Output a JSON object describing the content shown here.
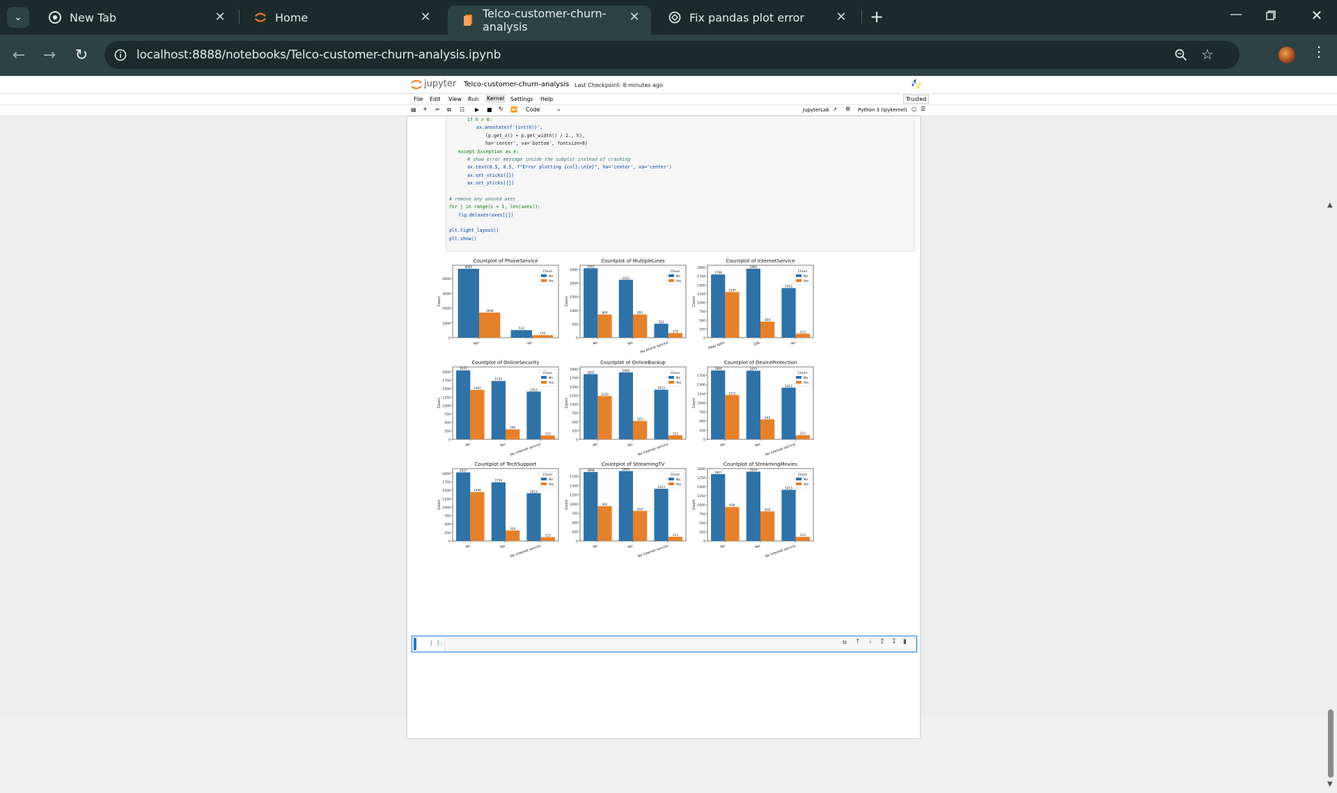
{
  "browser": {
    "tabs": [
      {
        "title": "New Tab",
        "icon": "chrome-icon"
      },
      {
        "title": "Home",
        "icon": "jupyter-icon"
      },
      {
        "title": "Telco-customer-churn-analysis",
        "icon": "notebook-icon"
      },
      {
        "title": "Fix pandas plot error",
        "icon": "chatgpt-icon"
      }
    ],
    "url": "localhost:8888/notebooks/Telco-customer-churn-analysis.ipynb"
  },
  "jupyter": {
    "logo_text": "jupyter",
    "notebook_title": "Telco-customer-churn-analysis",
    "checkpoint": "Last Checkpoint: 8 minutes ago",
    "menu": [
      "File",
      "Edit",
      "View",
      "Run",
      "Kernel",
      "Settings",
      "Help"
    ],
    "trusted": "Trusted",
    "cell_type": "Code",
    "jupyterlab_link": "JupyterLab",
    "kernel": "Python 3 (ipykernel)",
    "empty_prompt": "[ ]:"
  },
  "code_lines": [
    {
      "indent": 4,
      "html": "if h > 0:"
    },
    {
      "indent": 6,
      "html": "ax.annotate(f'{int(h)}',"
    },
    {
      "indent": 8,
      "html": "(p.get_x() + p.get_width() / 2., h),"
    },
    {
      "indent": 8,
      "html": "ha='center', va='bottom', fontsize=8)"
    },
    {
      "indent": 2,
      "html": "except Exception as e:"
    },
    {
      "indent": 4,
      "html": "# show error message inside the subplot instead of crashing"
    },
    {
      "indent": 4,
      "html": "ax.text(0.5, 0.5, f\"Error plotting {col}:\\n{e}\", ha='center', va='center')"
    },
    {
      "indent": 4,
      "html": "ax.set_xticks([])"
    },
    {
      "indent": 4,
      "html": "ax.set_yticks([])"
    },
    {
      "indent": 0,
      "html": ""
    },
    {
      "indent": 0,
      "html": "# remove any unused axes"
    },
    {
      "indent": 0,
      "html": "for j in range(i + 1, len(axes)):"
    },
    {
      "indent": 2,
      "html": "fig.delaxes(axes[j])"
    },
    {
      "indent": 0,
      "html": ""
    },
    {
      "indent": 0,
      "html": "plt.tight_layout()"
    },
    {
      "indent": 0,
      "html": "plt.show()"
    }
  ],
  "chart_data": [
    {
      "type": "bar",
      "title": "Countplot of PhoneService",
      "ylabel": "Count",
      "categories": [
        "Yes",
        "No"
      ],
      "ylim": [
        0,
        4900
      ],
      "yticks": [
        0,
        1000,
        2000,
        3000,
        4000
      ],
      "legend_title": "Churn",
      "series": [
        {
          "name": "No",
          "values": [
            4662,
            512
          ]
        },
        {
          "name": "Yes",
          "values": [
            1699,
            170
          ]
        }
      ]
    },
    {
      "type": "bar",
      "title": "Countplot of MultipleLines",
      "ylabel": "Count",
      "categories": [
        "No",
        "Yes",
        "No phone service"
      ],
      "ylim": [
        0,
        2650
      ],
      "yticks": [
        0,
        500,
        1000,
        1500,
        2000,
        2500
      ],
      "legend_title": "Churn",
      "series": [
        {
          "name": "No",
          "values": [
            2541,
            2121,
            512
          ]
        },
        {
          "name": "Yes",
          "values": [
            849,
            850,
            170
          ]
        }
      ]
    },
    {
      "type": "bar",
      "title": "Countplot of InternetService",
      "ylabel": "Count",
      "categories": [
        "Fiber optic",
        "DSL",
        "No"
      ],
      "ylim": [
        0,
        2060
      ],
      "yticks": [
        0,
        250,
        500,
        750,
        1000,
        1250,
        1500,
        1750,
        2000
      ],
      "legend_title": "Churn",
      "series": [
        {
          "name": "No",
          "values": [
            1799,
            1962,
            1413
          ]
        },
        {
          "name": "Yes",
          "values": [
            1297,
            459,
            113
          ]
        }
      ]
    },
    {
      "type": "bar",
      "title": "Countplot of OnlineSecurity",
      "ylabel": "Count",
      "categories": [
        "No",
        "Yes",
        "No internet service"
      ],
      "ylim": [
        0,
        2140
      ],
      "yticks": [
        0,
        250,
        500,
        750,
        1000,
        1250,
        1500,
        1750,
        2000
      ],
      "legend_title": "Churn",
      "series": [
        {
          "name": "No",
          "values": [
            2037,
            1724,
            1413
          ]
        },
        {
          "name": "Yes",
          "values": [
            1461,
            295,
            113
          ]
        }
      ]
    },
    {
      "type": "bar",
      "title": "Countplot of OnlineBackup",
      "ylabel": "Count",
      "categories": [
        "No",
        "Yes",
        "No internet service"
      ],
      "ylim": [
        0,
        2060
      ],
      "yticks": [
        0,
        250,
        500,
        750,
        1000,
        1250,
        1500,
        1750,
        2000
      ],
      "legend_title": "Churn",
      "series": [
        {
          "name": "No",
          "values": [
            1855,
            1906,
            1413
          ]
        },
        {
          "name": "Yes",
          "values": [
            1233,
            523,
            113
          ]
        }
      ]
    },
    {
      "type": "bar",
      "title": "Countplot of DeviceProtection",
      "ylabel": "Count",
      "categories": [
        "No",
        "Yes",
        "No internet service"
      ],
      "ylim": [
        0,
        1980
      ],
      "yticks": [
        0,
        250,
        500,
        750,
        1000,
        1250,
        1500,
        1750
      ],
      "legend_title": "Churn",
      "series": [
        {
          "name": "No",
          "values": [
            1884,
            1877,
            1413
          ]
        },
        {
          "name": "Yes",
          "values": [
            1211,
            545,
            113
          ]
        }
      ]
    },
    {
      "type": "bar",
      "title": "Countplot of TechSupport",
      "ylabel": "Count",
      "categories": [
        "No",
        "Yes",
        "No internet service"
      ],
      "ylim": [
        0,
        2140
      ],
      "yticks": [
        0,
        250,
        500,
        750,
        1000,
        1250,
        1500,
        1750,
        2000
      ],
      "legend_title": "Churn",
      "series": [
        {
          "name": "No",
          "values": [
            2027,
            1734,
            1413
          ]
        },
        {
          "name": "Yes",
          "values": [
            1446,
            310,
            113
          ]
        }
      ]
    },
    {
      "type": "bar",
      "title": "Countplot of StreamingTV",
      "ylabel": "Count",
      "categories": [
        "No",
        "Yes",
        "No internet service"
      ],
      "ylim": [
        0,
        1960
      ],
      "yticks": [
        0,
        250,
        500,
        750,
        1000,
        1250,
        1500,
        1750
      ],
      "legend_title": "Churn",
      "series": [
        {
          "name": "No",
          "values": [
            1868,
            1893,
            1413
          ]
        },
        {
          "name": "Yes",
          "values": [
            942,
            814,
            113
          ]
        }
      ]
    },
    {
      "type": "bar",
      "title": "Countplot of StreamingMovies",
      "ylabel": "Count",
      "categories": [
        "No",
        "Yes",
        "No internet service"
      ],
      "ylim": [
        0,
        2000
      ],
      "yticks": [
        0,
        250,
        500,
        750,
        1000,
        1250,
        1500,
        1750,
        2000
      ],
      "legend_title": "Churn",
      "series": [
        {
          "name": "No",
          "values": [
            1847,
            1914,
            1413
          ]
        },
        {
          "name": "Yes",
          "values": [
            938,
            818,
            113
          ]
        }
      ]
    }
  ],
  "colors": {
    "no": "#2f72a8",
    "yes": "#e5812a",
    "tab_bg": "#1b2b2b",
    "toolbar_bg": "#2d4343",
    "accent": "#f37726"
  }
}
